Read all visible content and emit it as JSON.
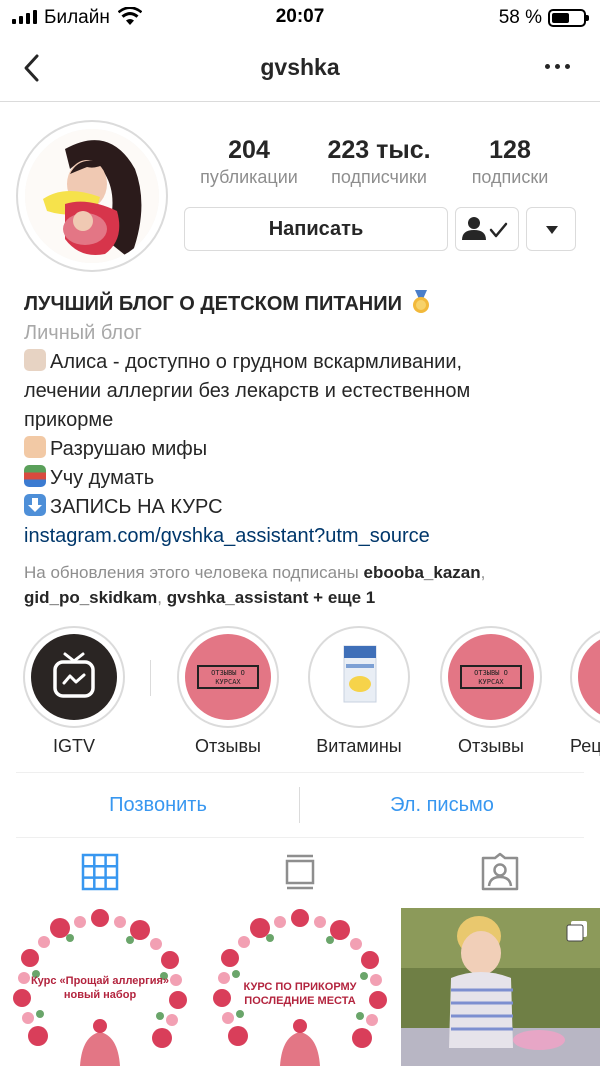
{
  "status_bar": {
    "carrier": "Билайн",
    "time": "20:07",
    "battery": "58 %",
    "battery_level": 0.58
  },
  "nav": {
    "title": "gvshka",
    "back_icon": "chevron-left-icon",
    "more_icon": "more-horizontal-icon"
  },
  "stats": [
    {
      "value": "204",
      "label": "публикации"
    },
    {
      "value": "223 тыс.",
      "label": "подписчики"
    },
    {
      "value": "128",
      "label": "подписки"
    }
  ],
  "actions": {
    "message_label": "Написать",
    "following_icon": "person-check-icon",
    "dropdown_icon": "caret-down-icon"
  },
  "bio": {
    "name": "ЛУЧШИЙ БЛОГ О ДЕТСКОМ ПИТАНИИ",
    "category": "Личный блог",
    "line1": "Алиса - доступно о грудном вскармливании,",
    "line2": "лечении аллергии без лекарств и естественном",
    "line3": "прикорме",
    "line4": "Разрушаю мифы",
    "line5": "Учу думать",
    "line6": "ЗАПИСЬ НА КУРС",
    "link": "instagram.com/gvshka_assistant?utm_source"
  },
  "followed_by": {
    "prefix": "На обновления этого человека подписаны",
    "user1": "ebooba_kazan",
    "sep1": ",",
    "user2": "gid_po_skidkam",
    "sep2": ",",
    "user3": "gvshka_assistant",
    "suffix": "+ еще 1"
  },
  "highlights": [
    {
      "label": "IGTV"
    },
    {
      "label": "Отзывы",
      "badge": "ОТЗЫВЫ О КУРСАХ"
    },
    {
      "label": "Витамины"
    },
    {
      "label": "Отзывы",
      "badge": "ОТЗЫВЫ О КУРСАХ"
    },
    {
      "label": "Реце"
    }
  ],
  "contact": {
    "call_label": "Позвонить",
    "email_label": "Эл. письмо"
  },
  "tabs": [
    {
      "icon": "grid-icon",
      "active": true
    },
    {
      "icon": "feed-icon",
      "active": false
    },
    {
      "icon": "tagged-icon",
      "active": false
    }
  ],
  "posts": [
    {
      "caption": "Курс «Прощай аллергия» новый набор"
    },
    {
      "caption": "КУРС ПО ПРИКОРМУ ПОСЛЕДНИЕ МЕСТА"
    },
    {
      "caption": ""
    }
  ],
  "colors": {
    "link_blue": "#3897f0",
    "bio_link": "#00376b",
    "highlight_pink": "#e37685"
  }
}
